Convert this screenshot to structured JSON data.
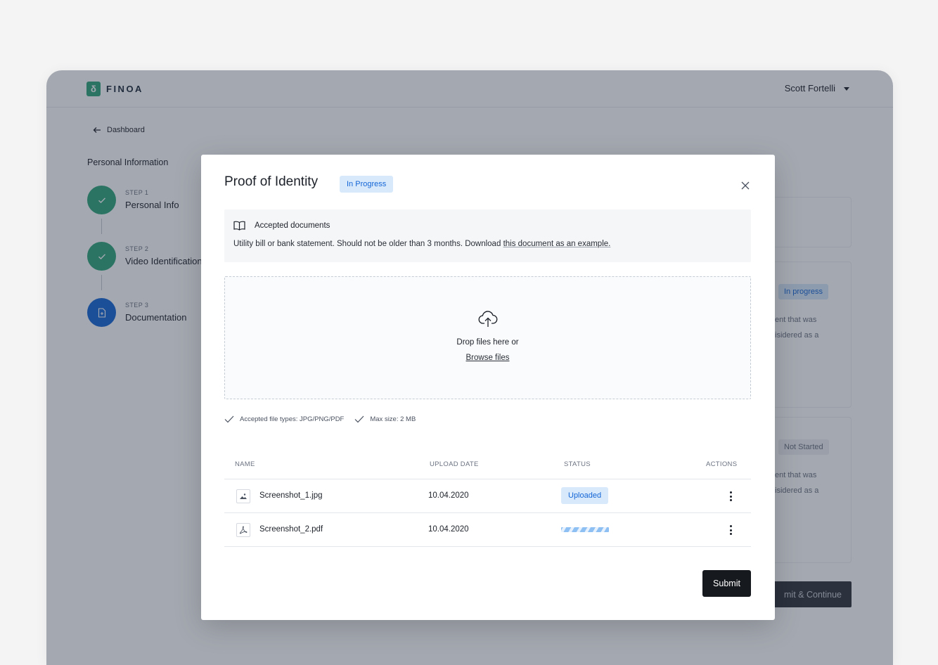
{
  "app": {
    "brand": "FINOA",
    "user_name": "Scott Fortelli"
  },
  "nav": {
    "back_label": "Dashboard"
  },
  "sidebar": {
    "section_title": "Personal Information",
    "steps": [
      {
        "step_label": "STEP 1",
        "name": "Personal Info",
        "state": "done"
      },
      {
        "step_label": "STEP 2",
        "name": "Video Identification",
        "state": "done"
      },
      {
        "step_label": "STEP 3",
        "name": "Documentation",
        "state": "current"
      }
    ]
  },
  "background": {
    "card1_badge": "In progress",
    "card1_line1": "ent that was",
    "card1_line2": "isidered as a",
    "card2_badge": "Not Started",
    "card2_line1": "ent that was",
    "card2_line2": "isidered as a",
    "continue_button": "mit & Continue"
  },
  "modal": {
    "title": "Proof of Identity",
    "status": "In Progress",
    "accepted_heading": "Accepted documents",
    "accepted_text": "Utility bill or bank statement. Should not be older than 3 months. Download ",
    "accepted_link": "this document as an example.",
    "drop_text": "Drop files here or",
    "browse_label": "Browse files",
    "hint_types": "Accepted file types: JPG/PNG/PDF",
    "hint_size": "Max size: 2 MB",
    "table": {
      "columns": [
        "NAME",
        "UPLOAD DATE",
        "STATUS",
        "ACTIONS"
      ],
      "rows": [
        {
          "name": "Screenshot_1.jpg",
          "date": "10.04.2020",
          "status": "Uploaded",
          "icon": "image-file-icon"
        },
        {
          "name": "Screenshot_2.pdf",
          "date": "10.04.2020",
          "status": "uploading",
          "icon": "pdf-file-icon"
        }
      ]
    },
    "submit_label": "Submit"
  },
  "colors": {
    "brand_green": "#2fa67b",
    "primary_blue": "#1466d6",
    "badge_blue_bg": "#d8e9fb",
    "dark_button": "#16191e"
  }
}
